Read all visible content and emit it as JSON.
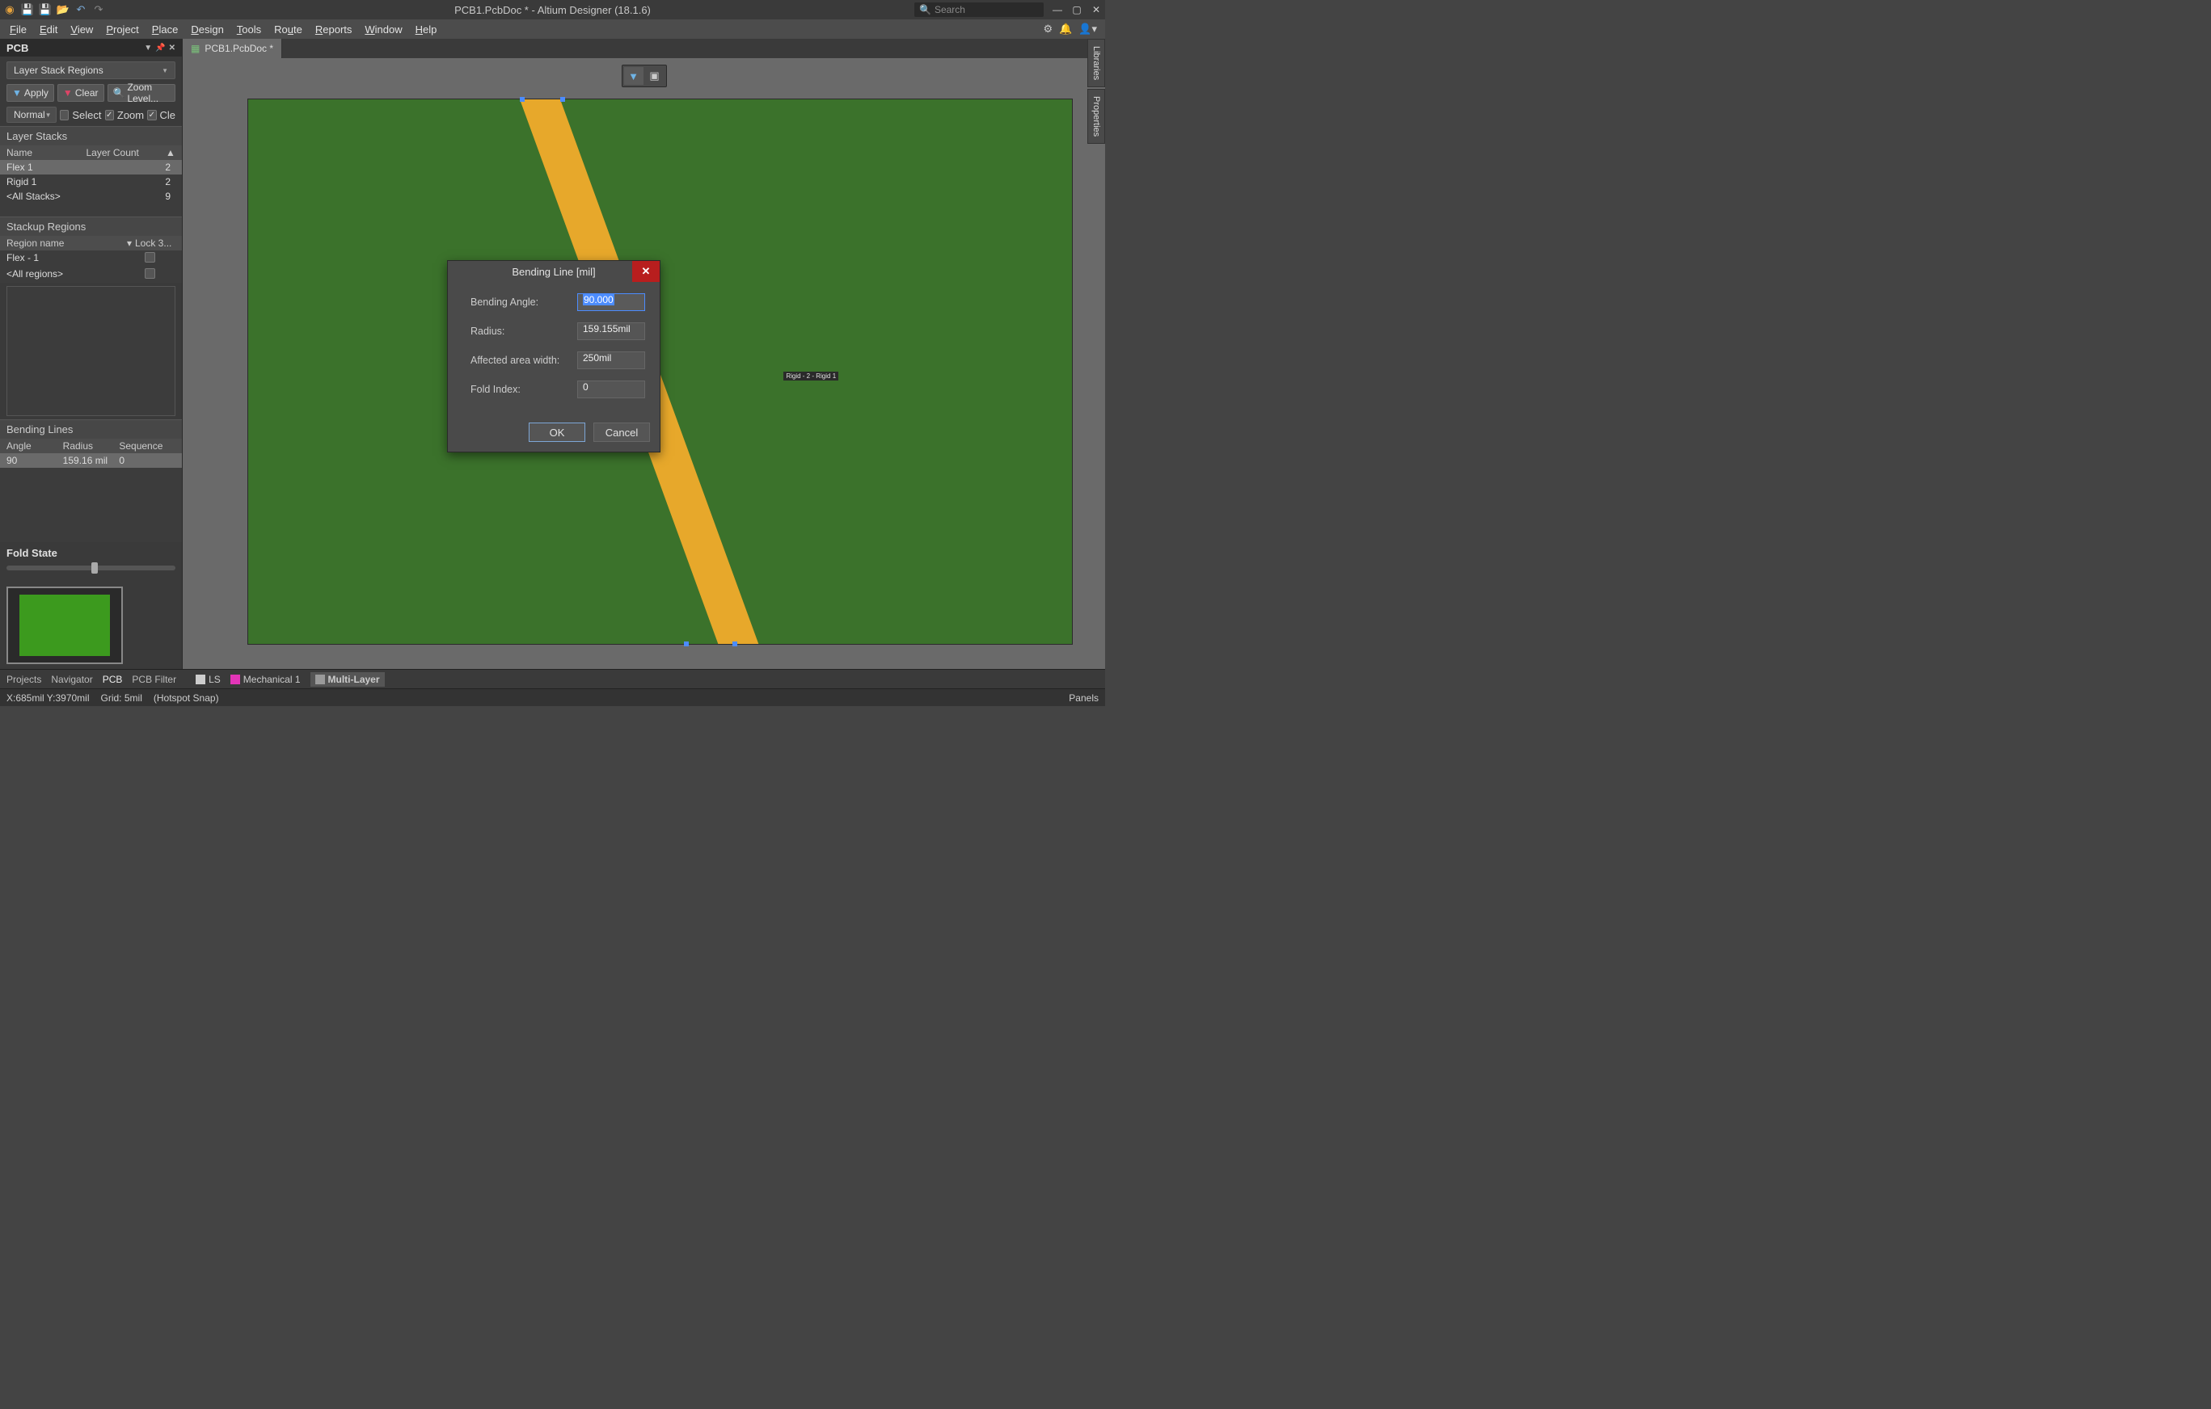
{
  "app": {
    "title": "PCB1.PcbDoc * - Altium Designer (18.1.6)",
    "search_placeholder": "Search"
  },
  "menu": [
    "File",
    "Edit",
    "View",
    "Project",
    "Place",
    "Design",
    "Tools",
    "Route",
    "Reports",
    "Window",
    "Help"
  ],
  "panel": {
    "title": "PCB",
    "filter_mode": "Layer Stack Regions",
    "apply": "Apply",
    "clear": "Clear",
    "zoom_level": "Zoom Level...",
    "normal": "Normal",
    "select_label": "Select",
    "zoom_label": "Zoom",
    "clear_tail": "Cle",
    "layer_stacks": {
      "header": "Layer Stacks",
      "cols": {
        "name": "Name",
        "count": "Layer Count"
      },
      "rows": [
        {
          "name": "Flex 1",
          "count": "2",
          "sel": true
        },
        {
          "name": "Rigid 1",
          "count": "2"
        },
        {
          "name": "<All Stacks>",
          "count": "9"
        }
      ]
    },
    "stackup_regions": {
      "header": "Stackup Regions",
      "cols": {
        "name": "Region name",
        "lock": "Lock 3..."
      },
      "rows": [
        {
          "name": "Flex - 1"
        },
        {
          "name": "<All regions>"
        }
      ]
    },
    "bending_lines": {
      "header": "Bending Lines",
      "cols": {
        "angle": "Angle",
        "radius": "Radius",
        "seq": "Sequence"
      },
      "rows": [
        {
          "angle": "90",
          "radius": "159.16 mil",
          "seq": "0",
          "sel": true
        }
      ]
    },
    "fold_state": "Fold State"
  },
  "doc_tab": "PCB1.PcbDoc *",
  "canvas_tooltip": "Rigid - 2 - Rigid 1",
  "dialog": {
    "title": "Bending Line [mil]",
    "fields": {
      "bending_angle": {
        "label": "Bending Angle:",
        "value": "90.000"
      },
      "radius": {
        "label": "Radius:",
        "value": "159.155mil"
      },
      "affected_width": {
        "label": "Affected area width:",
        "value": "250mil"
      },
      "fold_index": {
        "label": "Fold Index:",
        "value": "0"
      }
    },
    "ok": "OK",
    "cancel": "Cancel"
  },
  "right_tabs": [
    "Libraries",
    "Properties"
  ],
  "bottom_tabs": [
    "Projects",
    "Navigator",
    "PCB",
    "PCB Filter"
  ],
  "layers": {
    "ls": "LS",
    "mech": "Mechanical 1",
    "multi": "Multi-Layer"
  },
  "status": {
    "coords": "X:685mil Y:3970mil",
    "grid": "Grid: 5mil",
    "snap": "(Hotspot Snap)",
    "panels": "Panels"
  }
}
